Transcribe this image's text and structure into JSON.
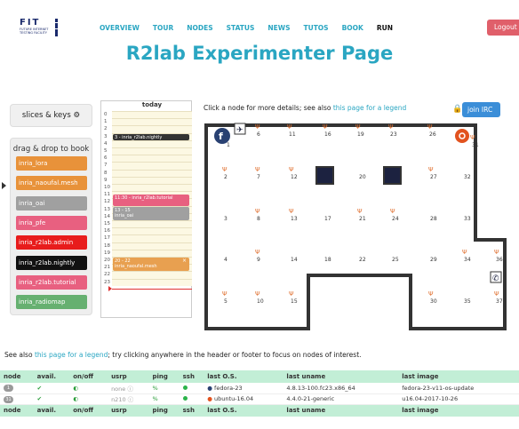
{
  "header": {
    "logo_text": "FIT",
    "logo_sub": "FUTURE INTERNET TESTING FACILITY",
    "nav": [
      "OVERVIEW",
      "TOUR",
      "NODES",
      "STATUS",
      "NEWS",
      "TUTOS",
      "BOOK",
      "RUN"
    ],
    "logout": "Logout",
    "title": "R2lab Experimenter Page"
  },
  "left": {
    "slices_label": "slices & keys",
    "slices_icon": "gear-icon",
    "drag_title": "drag & drop to book",
    "slices": [
      {
        "name": "inria_lora",
        "color": "#e8923a"
      },
      {
        "name": "inria_naoufal.mesh",
        "color": "#e8923a"
      },
      {
        "name": "inria_oai",
        "color": "#a0a0a0"
      },
      {
        "name": "inria_pfe",
        "color": "#e86080"
      },
      {
        "name": "inria_r2lab.admin",
        "color": "#e81c1c"
      },
      {
        "name": "inria_r2lab.nightly",
        "color": "#111111"
      },
      {
        "name": "inria_r2lab.tutorial",
        "color": "#e86080"
      },
      {
        "name": "inria_radiomap",
        "color": "#66b070"
      }
    ]
  },
  "calendar": {
    "today": "today",
    "hours": [
      "0",
      "1",
      "2",
      "3",
      "4",
      "5",
      "6",
      "7",
      "8",
      "9",
      "10",
      "11",
      "12",
      "13",
      "14",
      "15",
      "16",
      "17",
      "18",
      "19",
      "20",
      "21",
      "22",
      "23"
    ],
    "events": [
      {
        "label": "3 - inria_r2lab.nightly",
        "color": "#333333",
        "hour": 3,
        "dur": 1
      },
      {
        "label": "11:30 - inria_r2lab.tutorial",
        "color": "#e86080",
        "hour": 11.4,
        "dur": 1.6
      },
      {
        "label": "13 - 15\ninria_oai",
        "color": "#a0a0a0",
        "hour": 13,
        "dur": 2
      },
      {
        "label": "20 - 22\ninria_naoufal.mesh",
        "color": "#e8a050",
        "hour": 20,
        "dur": 2
      }
    ],
    "close_mark": "×"
  },
  "testbed": {
    "hint": "Click a node for more details; see also ",
    "hint_link": "this page for a legend",
    "irc": "join IRC",
    "lock_icon": "lock-icon",
    "nodes": [
      {
        "id": "1"
      },
      {
        "id": "6"
      },
      {
        "id": "11"
      },
      {
        "id": "16"
      },
      {
        "id": "19"
      },
      {
        "id": "23"
      },
      {
        "id": "26"
      },
      {
        "id": "31"
      },
      {
        "id": "2"
      },
      {
        "id": "7"
      },
      {
        "id": "12"
      },
      {
        "id": "20"
      },
      {
        "id": "27"
      },
      {
        "id": "32"
      },
      {
        "id": "3"
      },
      {
        "id": "8"
      },
      {
        "id": "13"
      },
      {
        "id": "17"
      },
      {
        "id": "21"
      },
      {
        "id": "24"
      },
      {
        "id": "28"
      },
      {
        "id": "33"
      },
      {
        "id": "4"
      },
      {
        "id": "9"
      },
      {
        "id": "14"
      },
      {
        "id": "18"
      },
      {
        "id": "22"
      },
      {
        "id": "25"
      },
      {
        "id": "29"
      },
      {
        "id": "34"
      },
      {
        "id": "36"
      },
      {
        "id": "5"
      },
      {
        "id": "10"
      },
      {
        "id": "15"
      },
      {
        "id": "30"
      },
      {
        "id": "35"
      },
      {
        "id": "37"
      }
    ]
  },
  "footer": {
    "see_also_pre": "See also ",
    "see_also_link": "this page for a legend",
    "see_also_post": "; try clicking anywhere in the header or footer to focus on nodes of interest.",
    "columns": [
      "node",
      "avail.",
      "on/off",
      "usrp",
      "ping",
      "ssh",
      "last O.S.",
      "last uname",
      "last image"
    ],
    "rows": [
      {
        "node": "1",
        "avail": "✔",
        "onoff": "◐",
        "usrp": "none ⓘ",
        "ping": "%",
        "ssh": "●",
        "os": "fedora-23",
        "os_icon": "fedora-icon",
        "uname": "4.8.13-100.fc23.x86_64",
        "image": "fedora-23-v11-os-update"
      },
      {
        "node": "31",
        "avail": "✔",
        "onoff": "◐",
        "usrp": "n210 ⓘ",
        "ping": "%",
        "ssh": "●",
        "os": "ubuntu-16.04",
        "os_icon": "ubuntu-icon",
        "uname": "4.4.0-21-generic",
        "image": "u16.04-2017-10-26"
      }
    ]
  },
  "colors": {
    "accent": "#2aa6c2",
    "irc": "#3b8ed8",
    "logout": "#e05f6a",
    "table_header": "#c2eed6"
  }
}
